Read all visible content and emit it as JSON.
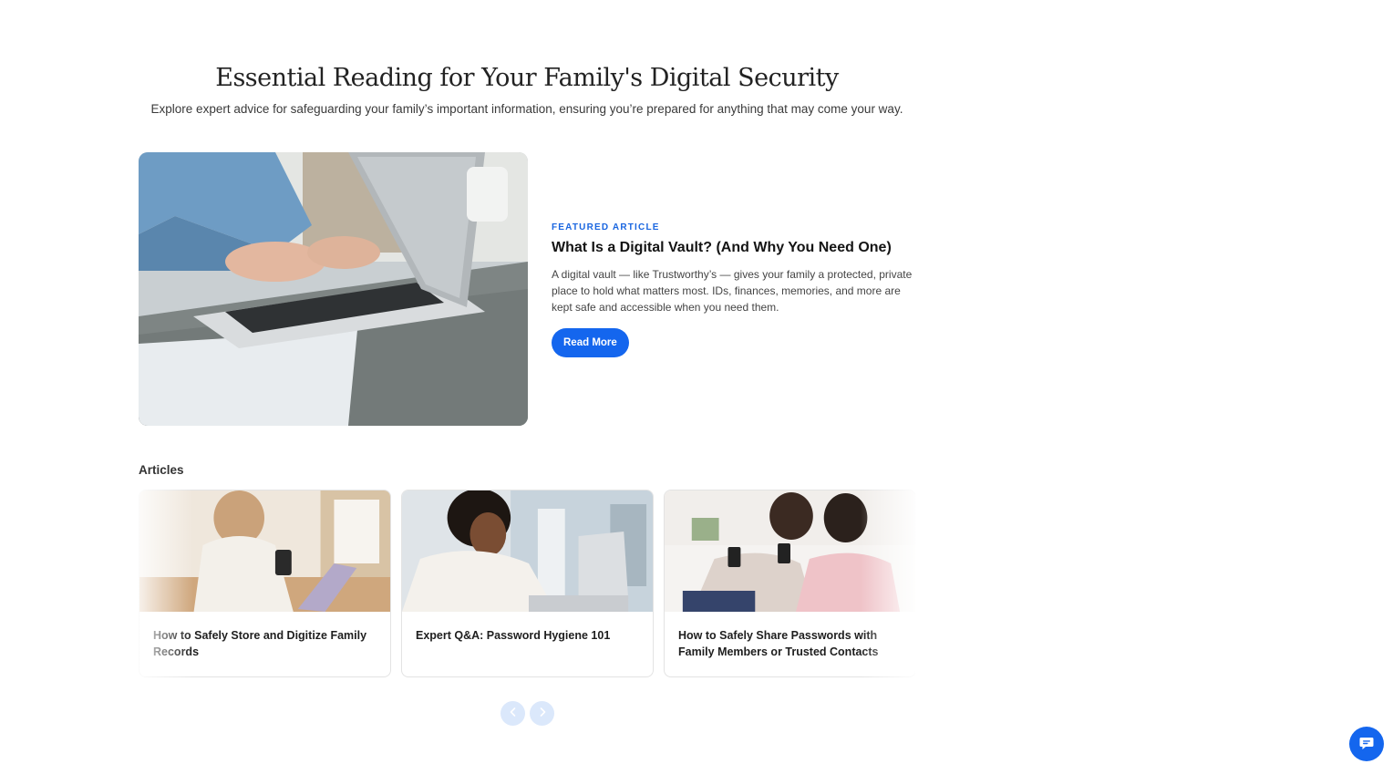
{
  "header": {
    "title": "Essential Reading for Your Family's Digital Security",
    "subtitle": "Explore expert advice for safeguarding your family’s important information, ensuring you’re prepared for anything that may come your way."
  },
  "featured": {
    "eyebrow": "FEATURED ARTICLE",
    "title": "What Is a Digital Vault? (And Why You Need One)",
    "description": "A digital vault — like Trustworthy’s — gives your family a protected, private place to hold what matters most. IDs, finances, memories, and more are kept safe and accessible when you need them.",
    "button_label": "Read More",
    "image_icon": "laptop-typing-photo"
  },
  "articles": {
    "heading": "Articles",
    "items": [
      {
        "title": "How to Safely Store and Digitize Family Records",
        "image_icon": "woman-phone-laptop-photo"
      },
      {
        "title": "Expert Q&A: Password Hygiene 101",
        "image_icon": "woman-laptop-photo"
      },
      {
        "title": "How to Safely Share Passwords with Family Members or Trusted Contacts",
        "image_icon": "two-women-phones-photo"
      }
    ]
  },
  "carousel_nav": {
    "prev_icon": "chevron-left-icon",
    "next_icon": "chevron-right-icon"
  },
  "chat": {
    "icon": "chat-bubble-icon"
  },
  "colors": {
    "accent": "#1466ee",
    "nav_button_bg": "#dbe8fb",
    "eyebrow": "#1a66e0"
  }
}
